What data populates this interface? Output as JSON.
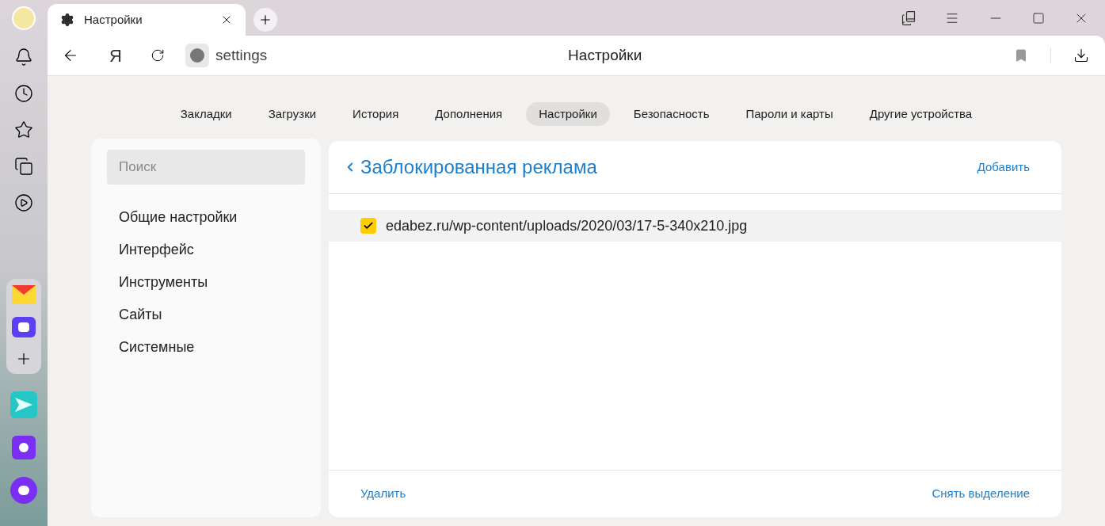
{
  "tab": {
    "title": "Настройки"
  },
  "toolbar": {
    "logo_letter": "Я",
    "address": "settings",
    "page_title": "Настройки"
  },
  "nav_tabs": [
    {
      "label": "Закладки",
      "selected": false
    },
    {
      "label": "Загрузки",
      "selected": false
    },
    {
      "label": "История",
      "selected": false
    },
    {
      "label": "Дополнения",
      "selected": false
    },
    {
      "label": "Настройки",
      "selected": true
    },
    {
      "label": "Безопасность",
      "selected": false
    },
    {
      "label": "Пароли и карты",
      "selected": false
    },
    {
      "label": "Другие устройства",
      "selected": false
    }
  ],
  "sidebar": {
    "search": {
      "placeholder": "Поиск"
    },
    "items": [
      "Общие настройки",
      "Интерфейс",
      "Инструменты",
      "Сайты",
      "Системные"
    ]
  },
  "panel": {
    "title": "Заблокированная реклама",
    "add": "Добавить",
    "rows": [
      {
        "url": "edabez.ru/wp-content/uploads/2020/03/17-5-340x210.jpg",
        "checked": true
      }
    ],
    "footer": {
      "delete": "Удалить",
      "deselect": "Снять выделение"
    }
  }
}
